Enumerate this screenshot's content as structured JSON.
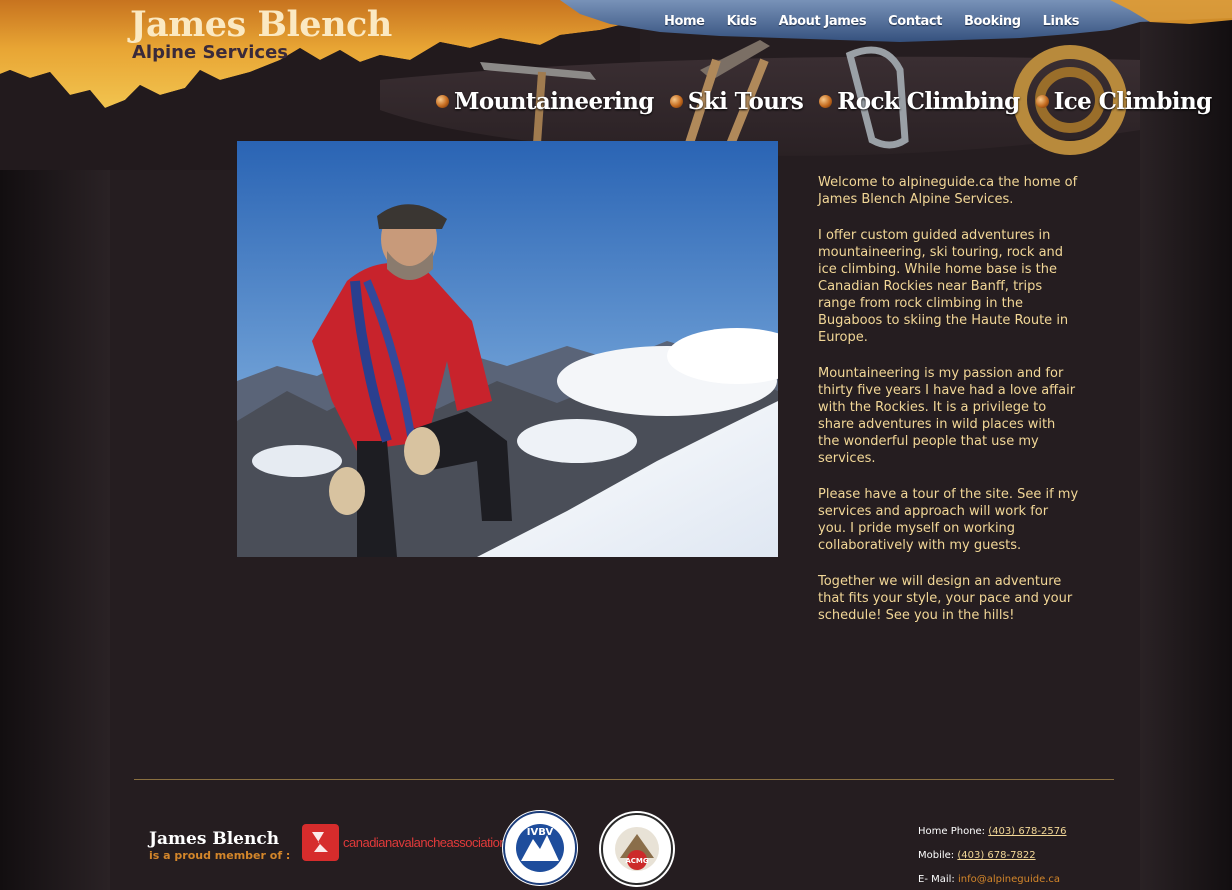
{
  "brand": {
    "name": "James Blench",
    "subtitle": "Alpine Services"
  },
  "top_nav": [
    {
      "label": "Home"
    },
    {
      "label": "Kids"
    },
    {
      "label": "About James"
    },
    {
      "label": "Contact"
    },
    {
      "label": "Booking"
    },
    {
      "label": "Links"
    }
  ],
  "service_nav": [
    {
      "label": "Mountaineering"
    },
    {
      "label": "Ski Tours"
    },
    {
      "label": "Rock Climbing"
    },
    {
      "label": "Ice Climbing"
    }
  ],
  "intro": {
    "paragraphs": [
      "Welcome to alpineguide.ca the home of James Blench Alpine Services.",
      "I offer custom guided adventures in mountaineering, ski touring, rock and ice climbing. While home base is the Canadian Rockies near Banff, trips range from rock climbing in the Bugaboos to skiing the Haute Route in Europe.",
      "Mountaineering is my passion and for thirty five years I have had a love affair with the Rockies. It is a privilege to share adventures in wild places with the wonderful people that use my services.",
      "Please have a tour of the site. See if my services and approach will work for you. I pride myself on working collaboratively with my guests.",
      "Together we will design an adventure that fits your style, your pace and your schedule! See you in the hills!"
    ]
  },
  "footer": {
    "name": "James Blench",
    "member_text": "is a proud member of :",
    "caa_text": "canadianavalancheassociation",
    "ivbv_text": "IVBV",
    "acmg_text": "ACMG",
    "home_phone_label": "Home Phone:",
    "home_phone": "(403) 678-2576",
    "mobile_label": "Mobile:",
    "mobile": "(403) 678-7822",
    "email_label": "E- Mail:",
    "email": "info@alpineguide.ca"
  },
  "colors": {
    "background": "#1a1517",
    "content": "#251d20",
    "intro_text": "#f2d797",
    "accent_orange": "#d4862a",
    "header_orange": "#e49b2c",
    "nav_blue": "#3d5d8e"
  }
}
